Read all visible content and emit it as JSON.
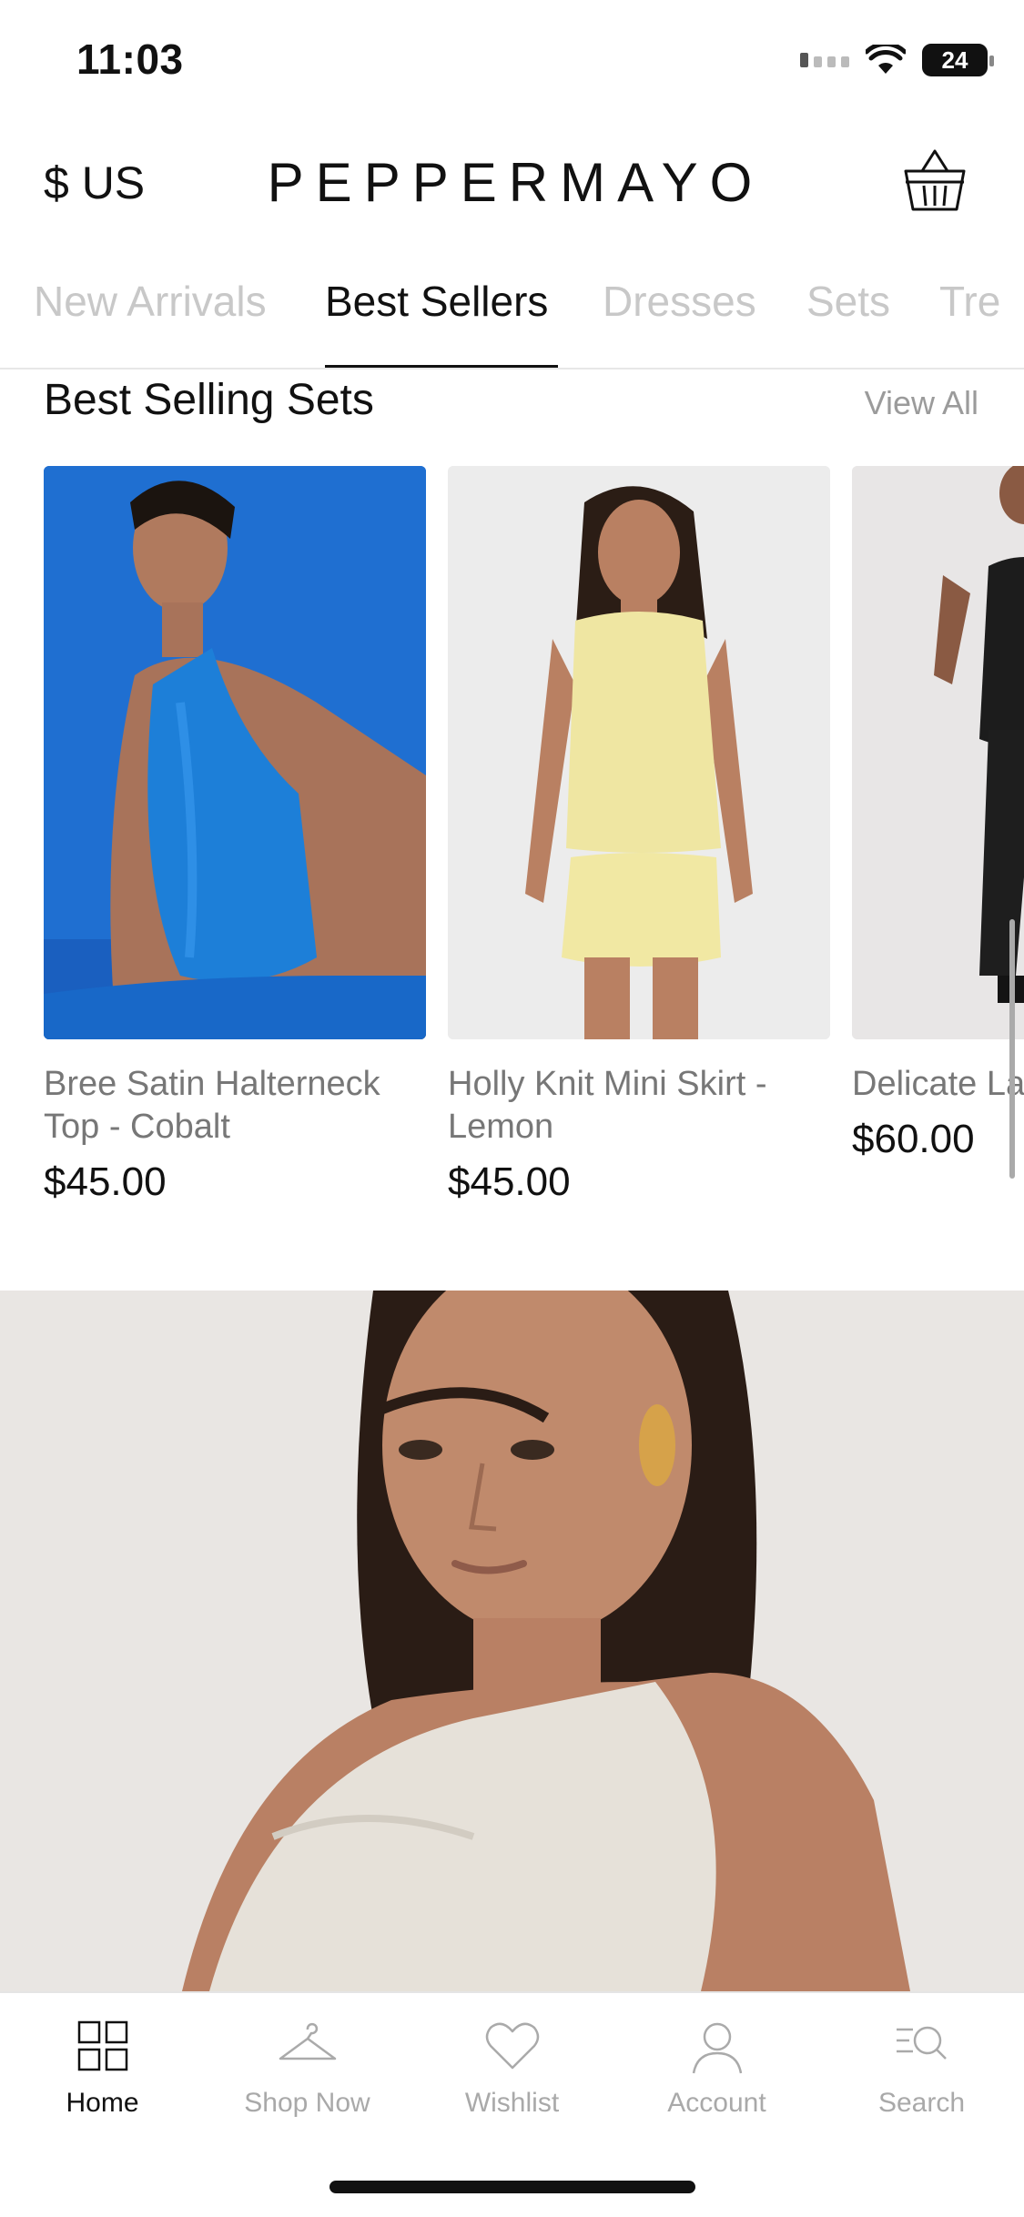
{
  "status_bar": {
    "time": "11:03",
    "battery": "24"
  },
  "header": {
    "currency": "$ US",
    "brand": "PEPPERMAYO"
  },
  "tabs": [
    {
      "label": "New Arrivals",
      "active": false
    },
    {
      "label": "Best Sellers",
      "active": true
    },
    {
      "label": "Dresses",
      "active": false
    },
    {
      "label": "Sets",
      "active": false
    },
    {
      "label": "Tre",
      "active": false
    }
  ],
  "section": {
    "title": "Best Selling Sets",
    "view_all": "View All"
  },
  "products": [
    {
      "name": "Bree Satin Halterneck Top - Cobalt",
      "price": "$45.00",
      "bg_color": "#1f6fd1"
    },
    {
      "name": "Holly Knit Mini Skirt - Lemon",
      "price": "$45.00",
      "bg_color": "#ececec"
    },
    {
      "name": "Delicate La Maxi Skirt",
      "price": "$60.00",
      "bg_color": "#e8e6e6"
    }
  ],
  "bottom_nav": [
    {
      "label": "Home",
      "icon": "grid-icon",
      "active": true
    },
    {
      "label": "Shop Now",
      "icon": "hanger-icon",
      "active": false
    },
    {
      "label": "Wishlist",
      "icon": "heart-icon",
      "active": false
    },
    {
      "label": "Account",
      "icon": "user-icon",
      "active": false
    },
    {
      "label": "Search",
      "icon": "search-icon",
      "active": false
    }
  ],
  "colors": {
    "active": "#111111",
    "inactive": "#a9a9a9",
    "tab_inactive": "#c8c8c8",
    "cobalt": "#1f6fd1",
    "lemon": "#efe6a2"
  }
}
